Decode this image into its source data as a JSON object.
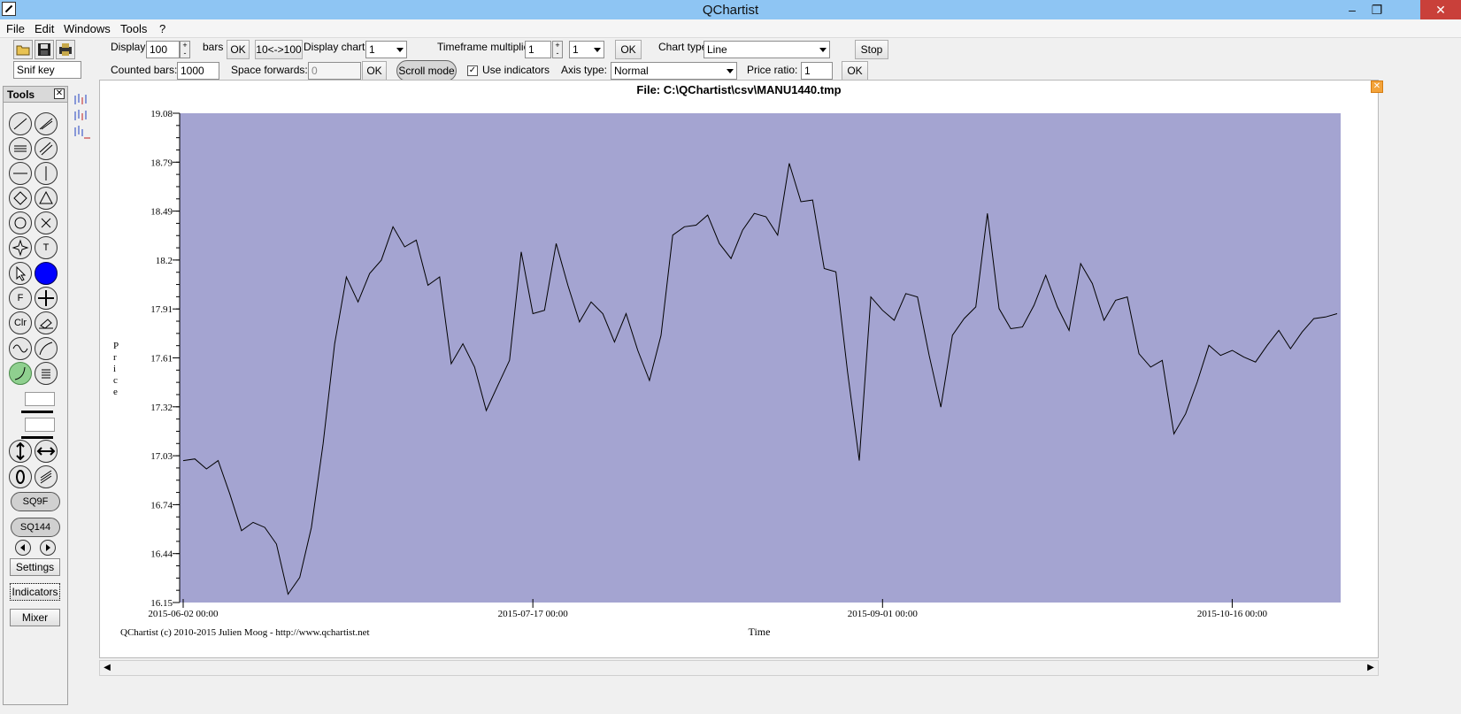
{
  "window": {
    "title": "QChartist",
    "min_label": "–",
    "restore_label": "❐",
    "close_label": "✕"
  },
  "menu": [
    "File",
    "Edit",
    "Windows",
    "Tools",
    "?"
  ],
  "toolbar": {
    "display_label": "Display",
    "display_value": "100",
    "bars_label": "bars",
    "ok1": "OK",
    "toggle_bars": "10<->100",
    "display_chart_label": "Display chart:",
    "display_chart_value": "1",
    "timeframe_label": "Timeframe multiplier:",
    "timeframe_value": "1",
    "timeframe_select": "1",
    "ok2": "OK",
    "chart_type_label": "Chart type:",
    "chart_type_value": "Line",
    "stop": "Stop",
    "snif_key": "Snif key",
    "counted_bars_label": "Counted bars:",
    "counted_bars_value": "1000",
    "space_forwards_label": "Space forwards:",
    "space_forwards_value": "0",
    "ok3": "OK",
    "scroll_mode": "Scroll mode",
    "use_indicators_label": "Use indicators",
    "use_indicators_checked": true,
    "axis_type_label": "Axis type:",
    "axis_type_value": "Normal",
    "price_ratio_label": "Price ratio:",
    "price_ratio_value": "1",
    "ok4": "OK"
  },
  "tools_panel": {
    "title": "Tools",
    "close": "✕",
    "buttons": [
      "F",
      "Clr",
      "T"
    ],
    "sq9f": "SQ9F",
    "sq144": "SQ144",
    "settings": "Settings",
    "indicators": "Indicators",
    "mixer": "Mixer",
    "colors": {
      "selected_color": "#0000ff",
      "active_tool": "#8fd08f"
    }
  },
  "chart": {
    "file_title": "File: C:\\QChartist\\csv\\MANU1440.tmp",
    "footer_credit": "QChartist (c) 2010-2015 Julien Moog - http://www.qchartist.net",
    "plot_bg": "#a4a4d1"
  },
  "chart_data": {
    "type": "line",
    "xlabel": "Time",
    "ylabel": "Price",
    "ylim": [
      16.15,
      19.08
    ],
    "yticks": [
      "19.08",
      "18.79",
      "18.49",
      "18.2",
      "17.91",
      "17.61",
      "17.32",
      "17.03",
      "16.74",
      "16.44",
      "16.15"
    ],
    "xticks": [
      {
        "index": 0,
        "label": "2015-06-02 00:00"
      },
      {
        "index": 30,
        "label": "2015-07-17 00:00"
      },
      {
        "index": 60,
        "label": "2015-09-01 00:00"
      },
      {
        "index": 90,
        "label": "2015-10-16 00:00"
      }
    ],
    "series": [
      {
        "values": [
          17.0,
          17.01,
          16.95,
          17.0,
          16.8,
          16.58,
          16.63,
          16.6,
          16.5,
          16.2,
          16.3,
          16.6,
          17.1,
          17.7,
          18.1,
          17.95,
          18.12,
          18.2,
          18.4,
          18.28,
          18.32,
          18.05,
          18.1,
          17.58,
          17.7,
          17.56,
          17.3,
          17.45,
          17.6,
          18.25,
          17.88,
          17.9,
          18.3,
          18.05,
          17.83,
          17.95,
          17.88,
          17.71,
          17.88,
          17.66,
          17.48,
          17.75,
          18.35,
          18.4,
          18.41,
          18.47,
          18.3,
          18.21,
          18.38,
          18.48,
          18.46,
          18.35,
          18.78,
          18.55,
          18.56,
          18.15,
          18.13,
          17.53,
          17.0,
          17.98,
          17.9,
          17.84,
          18.0,
          17.98,
          17.63,
          17.32,
          17.75,
          17.85,
          17.92,
          18.48,
          17.91,
          17.79,
          17.8,
          17.93,
          18.11,
          17.92,
          17.78,
          18.18,
          18.06,
          17.84,
          17.96,
          17.98,
          17.64,
          17.56,
          17.6,
          17.16,
          17.28,
          17.47,
          17.69,
          17.63,
          17.66,
          17.62,
          17.59,
          17.69,
          17.78,
          17.67,
          17.77,
          17.85,
          17.86,
          17.88
        ]
      }
    ]
  }
}
